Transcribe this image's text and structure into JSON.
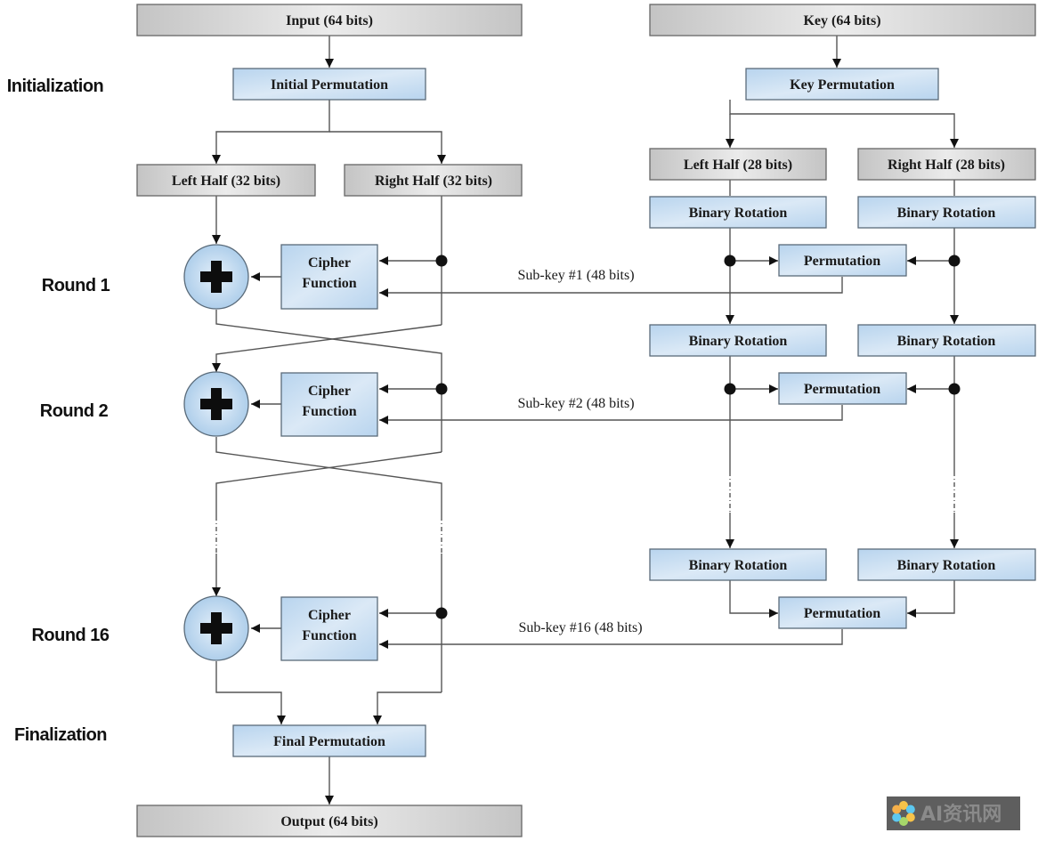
{
  "stages": {
    "initialization": "Initialization",
    "round1": "Round 1",
    "round2": "Round 2",
    "round16": "Round 16",
    "finalization": "Finalization"
  },
  "data_path": {
    "input": "Input (64 bits)",
    "initial_permutation": "Initial Permutation",
    "left_half": "Left Half (32 bits)",
    "right_half": "Right Half (32 bits)",
    "cipher_function_line1": "Cipher",
    "cipher_function_line2": "Function",
    "xor_symbol": "+",
    "final_permutation": "Final Permutation",
    "output": "Output (64 bits)"
  },
  "key_path": {
    "key": "Key (64 bits)",
    "key_permutation": "Key Permutation",
    "left_half": "Left Half (28 bits)",
    "right_half": "Right Half (28 bits)",
    "binary_rotation": "Binary Rotation",
    "permutation": "Permutation"
  },
  "subkeys": [
    "Sub-key #1 (48 bits)",
    "Sub-key #2 (48 bits)",
    "Sub-key #16 (48 bits)"
  ],
  "watermark": "AI资讯网",
  "colors": {
    "blue_box": "#c5dcf0",
    "gray_box": "#cfcfcf",
    "line": "#555555"
  }
}
